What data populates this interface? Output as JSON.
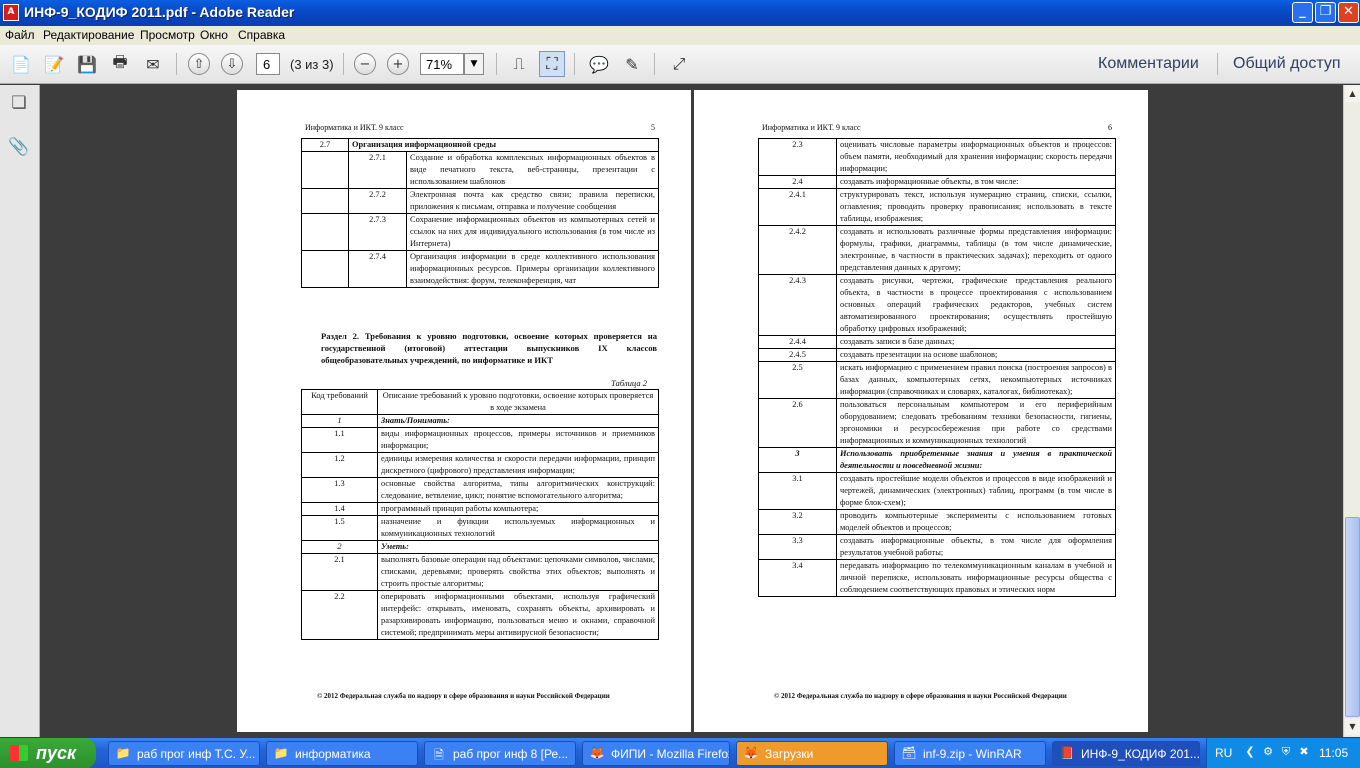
{
  "window": {
    "title": "ИНФ-9_КОДИФ 2011.pdf - Adobe Reader",
    "app_icon": "pdf-icon",
    "controls": [
      "minimize-icon",
      "maximize-icon",
      "close-icon"
    ]
  },
  "menu": [
    "Файл",
    "Редактирование",
    "Просмотр",
    "Окно",
    "Справка"
  ],
  "toolbar": {
    "page_input": "6",
    "page_count": "(3 из 3)",
    "zoom": "71%",
    "comments_label": "Комментарии",
    "share_label": "Общий доступ"
  },
  "left_page": {
    "header": "Информатика и ИКТ. 9 класс",
    "page_number": "5",
    "table1": [
      {
        "c1": "2.7",
        "c2": "",
        "text": "Организация информационной среды",
        "bold": true
      },
      {
        "c1": "",
        "c2": "2.7.1",
        "text": "Создание и обработка комплексных информационных объектов в виде печатного текста, веб-страницы, презентации с использованием шаблонов"
      },
      {
        "c1": "",
        "c2": "2.7.2",
        "text": "Электронная почта как средство связи; правила переписки, приложения к письмам, отправка и получение сообщения"
      },
      {
        "c1": "",
        "c2": "2.7.3",
        "text": "Сохранение информационных объектов из компьютерных сетей и ссылок на них для индивидуального использования (в том числе из Интернета)"
      },
      {
        "c1": "",
        "c2": "2.7.4",
        "text": "Организация информации в среде коллективного использования информационных ресурсов. Примеры организации коллективного взаимодействия: форум, телеконференция, чат"
      }
    ],
    "section_title": "Раздел 2. Требования к уровню подготовки, освоение которых проверяется на государственной (итоговой) аттестации выпускников IX классов общеобразовательных учреждений, по информатике и ИКТ",
    "table_caption": "Таблица 2",
    "table2_header": [
      "Код требований",
      "Описание требований к уровню подготовки, освоение которых проверяется в ходе экзамена"
    ],
    "table2": [
      {
        "code": "1",
        "text": "Знать/Понимать:",
        "heading": true
      },
      {
        "code": "1.1",
        "text": "виды информационных процессов, примеры источников и приемников информации;"
      },
      {
        "code": "1.2",
        "text": "единицы измерения количества и скорости передачи информации, принцип дискретного (цифрового) представления информации;"
      },
      {
        "code": "1.3",
        "text": "основные свойства алгоритма, типы алгоритмических конструкций: следование, ветвление, цикл; понятие вспомогательного алгоритма;"
      },
      {
        "code": "1.4",
        "text": "программный принцип работы компьютера;"
      },
      {
        "code": "1.5",
        "text": "назначение и функции используемых информационных и коммуникационных технологий"
      },
      {
        "code": "2",
        "text": "Уметь:",
        "heading": true
      },
      {
        "code": "2.1",
        "text": "выполнять базовые операции над объектами: цепочками символов, числами, списками, деревьями; проверять свойства этих объектов; выполнять и строить простые алгоритмы;"
      },
      {
        "code": "2.2",
        "text": "оперировать информационными объектами, используя графический интерфейс: открывать, именовать, сохранять объекты, архивировать и разархивировать информацию, пользоваться меню и окнами, справочной системой; предпринимать меры антивирусной безопасности;"
      }
    ],
    "footer": "© 2012 Федеральная служба по надзору в сфере образования и науки Российской Федерации"
  },
  "right_page": {
    "header": "Информатика и ИКТ. 9 класс",
    "page_number": "6",
    "table": [
      {
        "code": "2.3",
        "text": "оценивать числовые параметры информационных объектов и процессов: объем памяти, необходимый для хранения информации; скорость передачи информации;"
      },
      {
        "code": "2.4",
        "text": "создавать информационные объекты, в том числе:"
      },
      {
        "code": "2.4.1",
        "text": "структурировать текст, используя нумерацию страниц, списки, ссылки, оглавления; проводить проверку правописания; использовать в тексте таблицы, изображения;"
      },
      {
        "code": "2.4.2",
        "text": "создавать и использовать различные формы представления информации: формулы, графики, диаграммы, таблицы (в том числе динамические, электронные, в частности в практических задачах); переходить от одного представления данных к другому;"
      },
      {
        "code": "2.4.3",
        "text": "создавать рисунки, чертежи, графические представления реального объекта, в частности в процессе проектирования с использованием основных операций графических редакторов, учебных систем автоматизированного проектирования; осуществлять простейшую обработку цифровых изображений;"
      },
      {
        "code": "2.4.4",
        "text": "создавать записи в базе данных;"
      },
      {
        "code": "2.4.5",
        "text": "создавать презентации на основе шаблонов;"
      },
      {
        "code": "2.5",
        "text": "искать информацию с применением правил поиска (построения запросов) в базах данных, компьютерных сетях, некомпьютерных источниках информации (справочниках и словарях, каталогах, библиотеках);"
      },
      {
        "code": "2.6",
        "text": "пользоваться персональным компьютером и его периферийным оборудованием; следовать требованиям техники безопасности, гигиены, эргономики и ресурсосбережения при работе со средствами информационных и коммуникационных технологий"
      },
      {
        "code": "3",
        "text": "Использовать приобретенные знания и умения в практической деятельности и повседневной жизни:",
        "heading": true
      },
      {
        "code": "3.1",
        "text": "создавать простейшие модели объектов и процессов в виде изображений и чертежей, динамических (электронных) таблиц, программ (в том числе в форме блок-схем);"
      },
      {
        "code": "3.2",
        "text": "проводить компьютерные эксперименты с использованием готовых моделей объектов и процессов;"
      },
      {
        "code": "3.3",
        "text": "создавать информационные объекты, в том числе для оформления результатов учебной работы;"
      },
      {
        "code": "3.4",
        "text": "передавать информацию по телекоммуникационным каналам в учебной и личной переписке, использовать информационные ресурсы общества с соблюдением соответствующих правовых и этических норм"
      }
    ],
    "footer": "© 2012 Федеральная служба по надзору в сфере образования и науки Российской Федерации"
  },
  "taskbar": {
    "start_label": "пуск",
    "tasks": [
      {
        "label": "раб прог инф Т.С. У...",
        "icon": "folder-icon"
      },
      {
        "label": "информатика",
        "icon": "folder-icon"
      },
      {
        "label": "раб прог инф 8 [Ре...",
        "icon": "document-icon"
      },
      {
        "label": "ФИПИ - Mozilla Firefox",
        "icon": "firefox-icon"
      },
      {
        "label": "Загрузки",
        "icon": "firefox-icon"
      },
      {
        "label": "inf-9.zip - WinRAR",
        "icon": "archive-icon"
      },
      {
        "label": "ИНФ-9_КОДИФ 201...",
        "icon": "pdf-icon"
      }
    ],
    "language": "RU",
    "clock": "11:05"
  }
}
